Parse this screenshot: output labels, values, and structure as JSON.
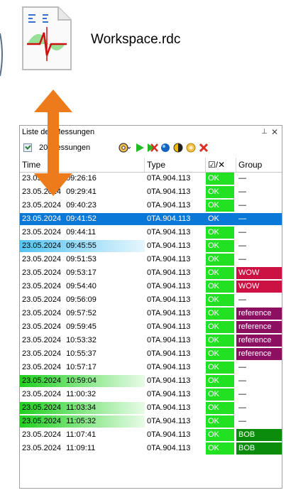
{
  "file": {
    "name": "Workspace.rdc",
    "icon": "data-file-icon"
  },
  "panel": {
    "title": "Liste der Messungen",
    "pin_icon": "pin-icon",
    "close_icon": "close-icon",
    "toolbar": {
      "selector_label": "20 Messungen",
      "icons": [
        "settings-icon",
        "play-icon",
        "run-all-icon",
        "circle-blue-icon",
        "circle-half-icon",
        "circle-yellow-icon",
        "delete-icon"
      ]
    },
    "columns": [
      "Time",
      "Type",
      "☑/✕",
      "Group"
    ],
    "rows": [
      {
        "date": "23.05.2024",
        "time": "09:26:16",
        "type": "0TA.904.113",
        "status": "OK",
        "group": "—",
        "highlight": "",
        "group_style": ""
      },
      {
        "date": "23.05.2024",
        "time": "09:29:41",
        "type": "0TA.904.113",
        "status": "OK",
        "group": "—",
        "highlight": "",
        "group_style": ""
      },
      {
        "date": "23.05.2024",
        "time": "09:40:23",
        "type": "0TA.904.113",
        "status": "OK",
        "group": "—",
        "highlight": "",
        "group_style": ""
      },
      {
        "date": "23.05.2024",
        "time": "09:41:52",
        "type": "0TA.904.113",
        "status": "OK",
        "group": "—",
        "highlight": "selected",
        "group_style": ""
      },
      {
        "date": "23.05.2024",
        "time": "09:44:11",
        "type": "0TA.904.113",
        "status": "OK",
        "group": "—",
        "highlight": "",
        "group_style": ""
      },
      {
        "date": "23.05.2024",
        "time": "09:45:55",
        "type": "0TA.904.113",
        "status": "OK",
        "group": "—",
        "highlight": "blue",
        "group_style": ""
      },
      {
        "date": "23.05.2024",
        "time": "09:51:53",
        "type": "0TA.904.113",
        "status": "OK",
        "group": "—",
        "highlight": "",
        "group_style": ""
      },
      {
        "date": "23.05.2024",
        "time": "09:53:17",
        "type": "0TA.904.113",
        "status": "OK",
        "group": "WOW",
        "highlight": "",
        "group_style": "wow"
      },
      {
        "date": "23.05.2024",
        "time": "09:54:40",
        "type": "0TA.904.113",
        "status": "OK",
        "group": "WOW",
        "highlight": "",
        "group_style": "wow"
      },
      {
        "date": "23.05.2024",
        "time": "09:56:09",
        "type": "0TA.904.113",
        "status": "OK",
        "group": "—",
        "highlight": "",
        "group_style": ""
      },
      {
        "date": "23.05.2024",
        "time": "09:57:52",
        "type": "0TA.904.113",
        "status": "OK",
        "group": "reference",
        "highlight": "",
        "group_style": "ref"
      },
      {
        "date": "23.05.2024",
        "time": "09:59:45",
        "type": "0TA.904.113",
        "status": "OK",
        "group": "reference",
        "highlight": "",
        "group_style": "ref"
      },
      {
        "date": "23.05.2024",
        "time": "10:53:32",
        "type": "0TA.904.113",
        "status": "OK",
        "group": "reference",
        "highlight": "",
        "group_style": "ref"
      },
      {
        "date": "23.05.2024",
        "time": "10:55:37",
        "type": "0TA.904.113",
        "status": "OK",
        "group": "reference",
        "highlight": "",
        "group_style": "ref"
      },
      {
        "date": "23.05.2024",
        "time": "10:57:17",
        "type": "0TA.904.113",
        "status": "OK",
        "group": "—",
        "highlight": "",
        "group_style": ""
      },
      {
        "date": "23.05.2024",
        "time": "10:59:04",
        "type": "0TA.904.113",
        "status": "OK",
        "group": "—",
        "highlight": "green",
        "group_style": ""
      },
      {
        "date": "23.05.2024",
        "time": "11:00:32",
        "type": "0TA.904.113",
        "status": "OK",
        "group": "—",
        "highlight": "",
        "group_style": ""
      },
      {
        "date": "23.05.2024",
        "time": "11:03:34",
        "type": "0TA.904.113",
        "status": "OK",
        "group": "—",
        "highlight": "green",
        "group_style": ""
      },
      {
        "date": "23.05.2024",
        "time": "11:05:32",
        "type": "0TA.904.113",
        "status": "OK",
        "group": "—",
        "highlight": "green",
        "group_style": ""
      },
      {
        "date": "23.05.2024",
        "time": "11:07:41",
        "type": "0TA.904.113",
        "status": "OK",
        "group": "BOB",
        "highlight": "",
        "group_style": "bob"
      },
      {
        "date": "23.05.2024",
        "time": "11:09:11",
        "type": "0TA.904.113",
        "status": "OK",
        "group": "BOB",
        "highlight": "",
        "group_style": "bob"
      }
    ]
  },
  "overlay": {
    "arrow_icon": "double-arrow-icon",
    "arrow_color": "#ee7b1b"
  }
}
